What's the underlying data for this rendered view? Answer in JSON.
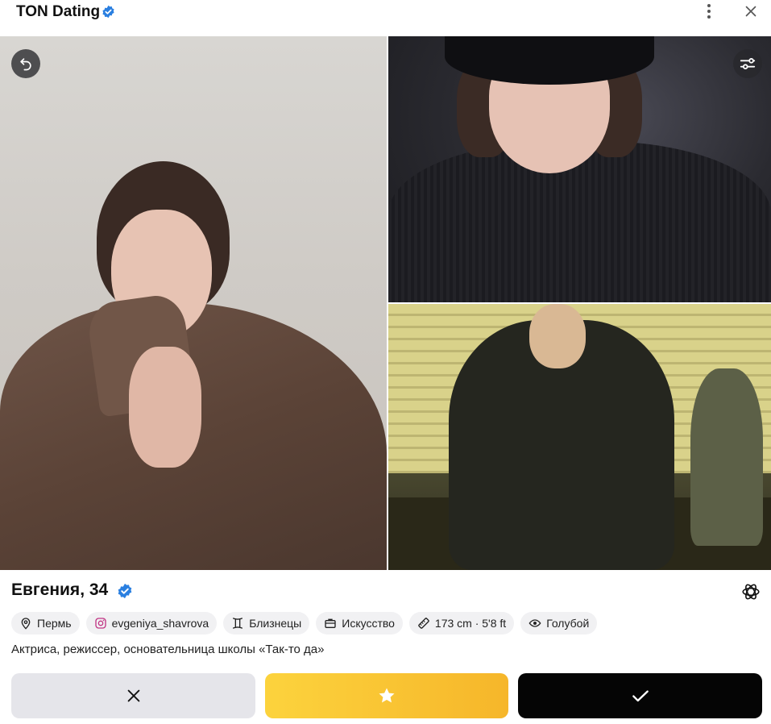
{
  "header": {
    "title": "TON Dating",
    "verified_icon": "verified-badge-icon",
    "menu_icon": "vertical-dots-icon",
    "close_icon": "close-icon"
  },
  "photos": {
    "undo_icon": "undo-icon",
    "filter_icon": "filter-sliders-icon"
  },
  "profile": {
    "name_age": "Евгения, 34",
    "verified_icon": "verified-badge-icon",
    "ai_icon": "openai-icon",
    "tags": [
      {
        "icon": "location-pin-icon",
        "label": "Пермь"
      },
      {
        "icon": "instagram-icon",
        "label": "evgeniya_shavrova"
      },
      {
        "icon": "gemini-zodiac-icon",
        "label": "Близнецы"
      },
      {
        "icon": "briefcase-icon",
        "label": "Искусство"
      },
      {
        "icon": "ruler-icon",
        "label": "173 cm · 5'8 ft"
      },
      {
        "icon": "eye-icon",
        "label": "Голубой"
      }
    ],
    "bio": "Актриса, режиссер, основательница школы «Так-то да»"
  },
  "actions": {
    "dislike_icon": "x-icon",
    "superlike_icon": "star-icon",
    "like_icon": "checkmark-icon"
  },
  "colors": {
    "verified_blue": "#2a7fe0",
    "superlike_gradient_start": "#fcd33d",
    "superlike_gradient_end": "#f6b62a",
    "like_bg": "#050505",
    "dislike_bg": "#e5e5ea",
    "tag_bg": "#f1f1f3"
  }
}
